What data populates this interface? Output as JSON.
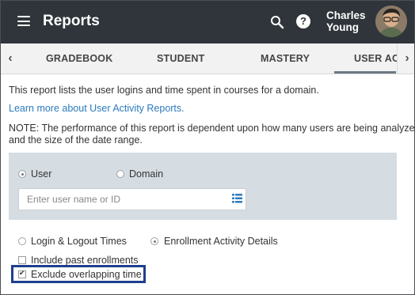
{
  "header": {
    "title": "Reports",
    "user_name": "Charles Young",
    "icons": [
      "menu-icon",
      "search-icon",
      "help-icon",
      "avatar"
    ]
  },
  "tabs": {
    "items": [
      "GRADEBOOK",
      "STUDENT",
      "MASTERY",
      "USER ACT"
    ],
    "active": "USER ACT"
  },
  "intro": {
    "description": "This report lists the user logins and time spent in courses for a domain.",
    "learn_more": "Learn more about User Activity Reports.",
    "note_line1": "NOTE: The performance of this report is dependent upon how many users are being analyzed",
    "note_line2": "and the size of the date range."
  },
  "filter": {
    "scope_options": [
      "User",
      "Domain"
    ],
    "scope_selected": "User",
    "search_placeholder": "Enter user name or ID",
    "search_value": ""
  },
  "report_type": {
    "options": [
      "Login & Logout Times",
      "Enrollment Activity Details"
    ],
    "selected": "Enrollment Activity Details"
  },
  "options": {
    "include_past_label": "Include past enrollments",
    "include_past_checked": false,
    "exclude_overlap_label": "Exclude overlapping time",
    "exclude_overlap_checked": true
  },
  "colors": {
    "app_bar": "#2f353b",
    "link": "#2b7bbd",
    "panel": "#d5dde3",
    "highlight": "#1e3f8c"
  }
}
